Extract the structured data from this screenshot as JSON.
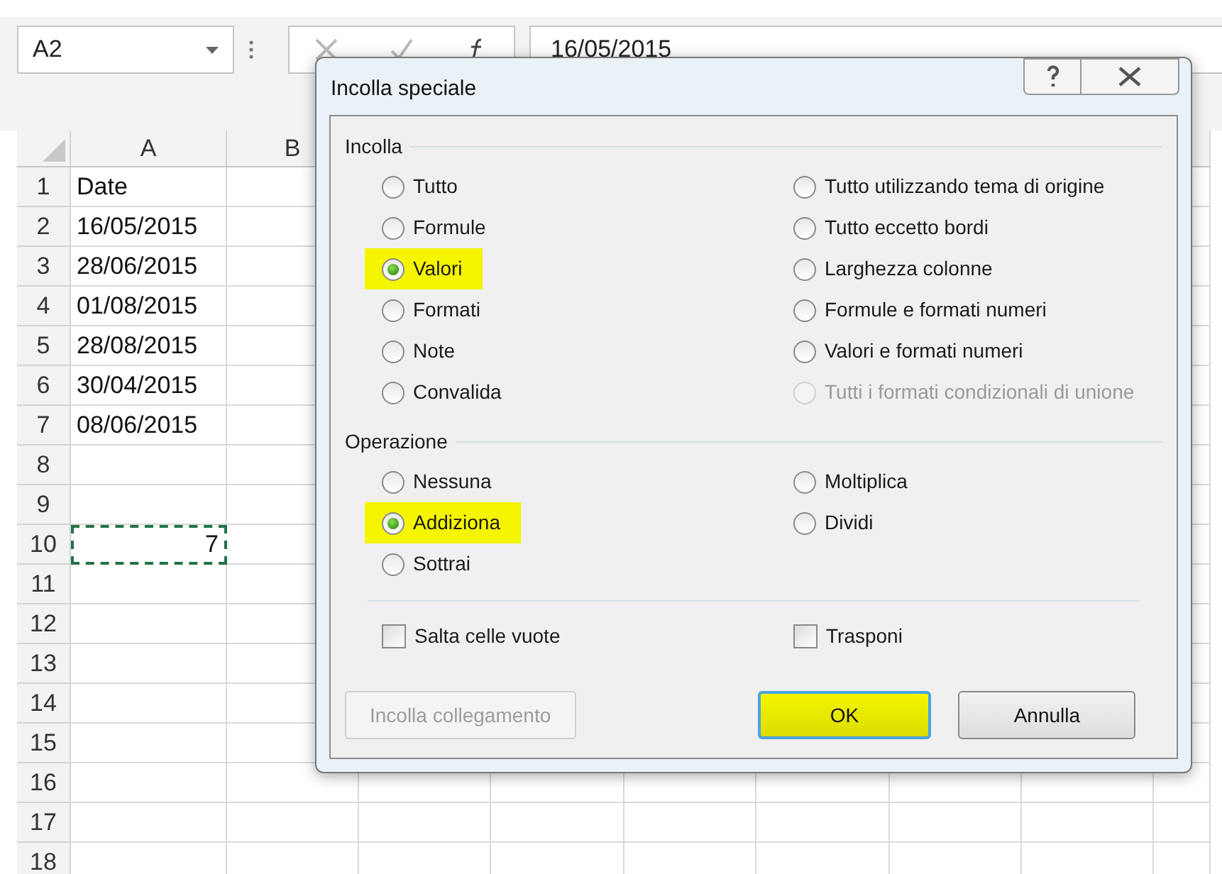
{
  "name_box": {
    "value": "A2"
  },
  "formula_bar": {
    "value": "16/05/2015"
  },
  "columns": [
    "A",
    "B"
  ],
  "rows": [
    {
      "number": "1",
      "cells": [
        {
          "value": "Date",
          "kind": "text",
          "copy_marquee": false
        }
      ]
    },
    {
      "number": "2",
      "cells": [
        {
          "value": "16/05/2015",
          "kind": "text",
          "copy_marquee": false
        }
      ]
    },
    {
      "number": "3",
      "cells": [
        {
          "value": "28/06/2015",
          "kind": "text",
          "copy_marquee": false
        }
      ]
    },
    {
      "number": "4",
      "cells": [
        {
          "value": "01/08/2015",
          "kind": "text",
          "copy_marquee": false
        }
      ]
    },
    {
      "number": "5",
      "cells": [
        {
          "value": "28/08/2015",
          "kind": "text",
          "copy_marquee": false
        }
      ]
    },
    {
      "number": "6",
      "cells": [
        {
          "value": "30/04/2015",
          "kind": "text",
          "copy_marquee": false
        }
      ]
    },
    {
      "number": "7",
      "cells": [
        {
          "value": "08/06/2015",
          "kind": "text",
          "copy_marquee": false
        }
      ]
    },
    {
      "number": "8",
      "cells": []
    },
    {
      "number": "9",
      "cells": []
    },
    {
      "number": "10",
      "cells": [
        {
          "value": "7",
          "kind": "number",
          "copy_marquee": true
        }
      ]
    },
    {
      "number": "11",
      "cells": []
    },
    {
      "number": "12",
      "cells": []
    },
    {
      "number": "13",
      "cells": []
    },
    {
      "number": "14",
      "cells": []
    },
    {
      "number": "15",
      "cells": []
    },
    {
      "number": "16",
      "cells": []
    },
    {
      "number": "17",
      "cells": []
    },
    {
      "number": "18",
      "cells": []
    }
  ],
  "dialog": {
    "title": "Incolla speciale",
    "groups": [
      {
        "label": "Incolla",
        "options": [
          {
            "label": "Tutto",
            "selected": false,
            "disabled": false,
            "highlighted": false
          },
          {
            "label": "Tutto utilizzando tema di origine",
            "selected": false,
            "disabled": false,
            "highlighted": false
          },
          {
            "label": "Formule",
            "selected": false,
            "disabled": false,
            "highlighted": false
          },
          {
            "label": "Tutto eccetto bordi",
            "selected": false,
            "disabled": false,
            "highlighted": false
          },
          {
            "label": "Valori",
            "selected": true,
            "disabled": false,
            "highlighted": true
          },
          {
            "label": "Larghezza colonne",
            "selected": false,
            "disabled": false,
            "highlighted": false
          },
          {
            "label": "Formati",
            "selected": false,
            "disabled": false,
            "highlighted": false
          },
          {
            "label": "Formule e formati numeri",
            "selected": false,
            "disabled": false,
            "highlighted": false
          },
          {
            "label": "Note",
            "selected": false,
            "disabled": false,
            "highlighted": false
          },
          {
            "label": "Valori e formati numeri",
            "selected": false,
            "disabled": false,
            "highlighted": false
          },
          {
            "label": "Convalida",
            "selected": false,
            "disabled": false,
            "highlighted": false
          },
          {
            "label": "Tutti i formati condizionali di unione",
            "selected": false,
            "disabled": true,
            "highlighted": false
          }
        ]
      },
      {
        "label": "Operazione",
        "options": [
          {
            "label": "Nessuna",
            "selected": false,
            "disabled": false,
            "highlighted": false
          },
          {
            "label": "Moltiplica",
            "selected": false,
            "disabled": false,
            "highlighted": false
          },
          {
            "label": "Addiziona",
            "selected": true,
            "disabled": false,
            "highlighted": true
          },
          {
            "label": "Dividi",
            "selected": false,
            "disabled": false,
            "highlighted": false
          },
          {
            "label": "Sottrai",
            "selected": false,
            "disabled": false,
            "highlighted": false
          }
        ]
      }
    ],
    "checkboxes": [
      {
        "label": "Salta celle vuote",
        "checked": false
      },
      {
        "label": "Trasponi",
        "checked": false
      }
    ],
    "buttons": [
      {
        "label": "Incolla collegamento",
        "disabled": true,
        "default": false,
        "highlighted": false
      },
      {
        "label": "OK",
        "disabled": false,
        "default": true,
        "highlighted": true
      },
      {
        "label": "Annulla",
        "disabled": false,
        "default": false,
        "highlighted": false
      }
    ]
  }
}
